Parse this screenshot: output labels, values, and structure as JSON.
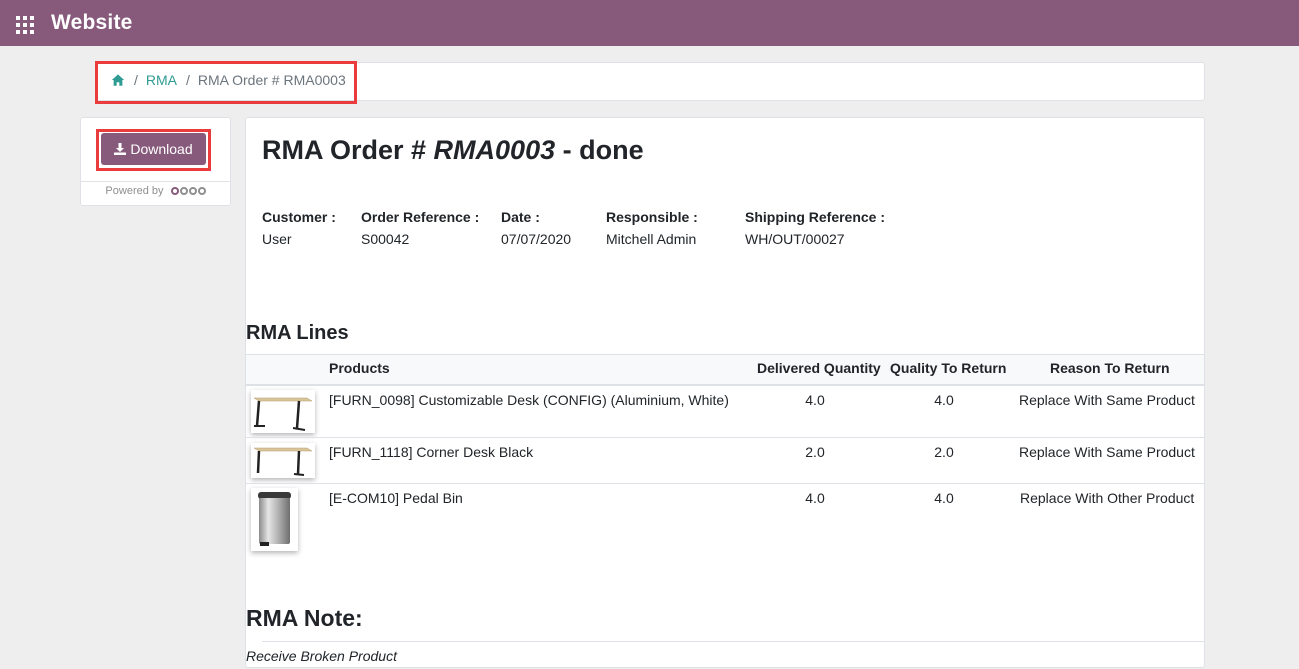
{
  "header": {
    "app_title": "Website",
    "apps_icon": "apps-grid-icon"
  },
  "breadcrumb": {
    "home_icon": "home-icon",
    "rma_link": "RMA",
    "current": "RMA Order # RMA0003",
    "separator": "/"
  },
  "sidebar": {
    "download_label": "Download",
    "download_icon": "download-icon",
    "powered_by": "Powered by",
    "brand": "odoo"
  },
  "order": {
    "title_prefix": "RMA Order # ",
    "number": "RMA0003",
    "title_suffix": " - done",
    "fields": [
      {
        "label": "Customer :",
        "value": "User"
      },
      {
        "label": "Order Reference :",
        "value": "S00042"
      },
      {
        "label": "Date :",
        "value": "07/07/2020"
      },
      {
        "label": "Responsible :",
        "value": "Mitchell Admin"
      },
      {
        "label": "Shipping Reference :",
        "value": "WH/OUT/00027"
      }
    ]
  },
  "lines": {
    "section_title": "RMA Lines",
    "columns": [
      "Products",
      "Delivered Quantity",
      "Quality To Return",
      "Reason To Return"
    ],
    "rows": [
      {
        "product": "[FURN_0098] Customizable Desk (CONFIG) (Aluminium, White)",
        "delivered": "4.0",
        "to_return": "4.0",
        "reason": "Replace With Same Product",
        "image": "desk-image"
      },
      {
        "product": "[FURN_1118] Corner Desk Black",
        "delivered": "2.0",
        "to_return": "2.0",
        "reason": "Replace With Same Product",
        "image": "desk-image"
      },
      {
        "product": "[E-COM10] Pedal Bin",
        "delivered": "4.0",
        "to_return": "4.0",
        "reason": "Replace With Other Product",
        "image": "pedal-bin-image"
      }
    ]
  },
  "note": {
    "section_title": "RMA Note:",
    "text": "Receive Broken Product"
  },
  "colors": {
    "brand": "#875a7b",
    "link": "#2f9c94",
    "highlight": "#ea3c3c"
  }
}
